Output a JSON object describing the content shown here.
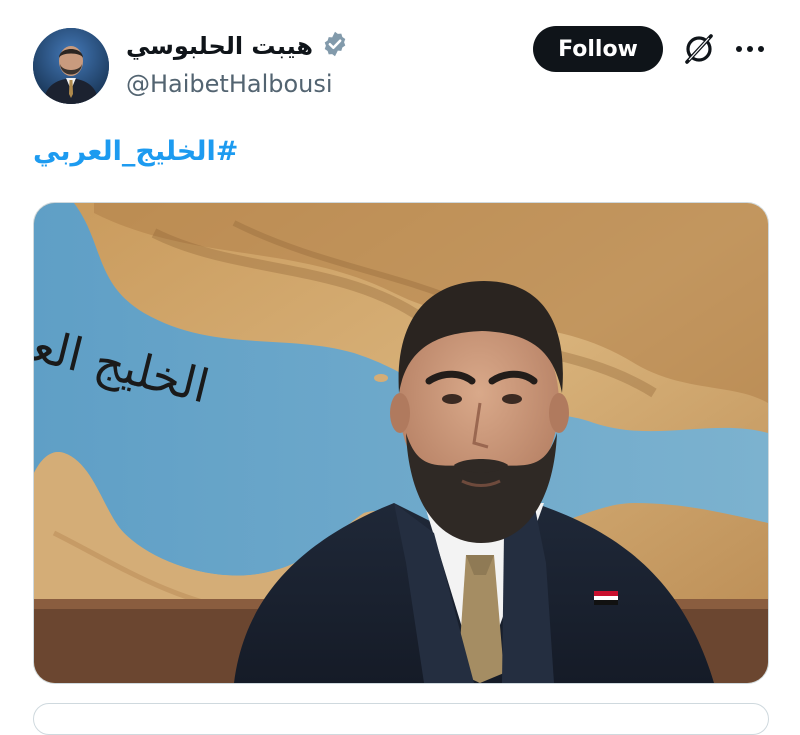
{
  "tweet": {
    "author": {
      "display_name": "هيبت الحلبوسي",
      "handle": "@HaibetHalbousi",
      "verified": true,
      "avatar_icon": "profile-photo"
    },
    "actions": {
      "follow_label": "Follow",
      "grok_icon": "grok-icon",
      "more_icon": "more-options-icon"
    },
    "text": {
      "hashtag": "#الخليج_العربي"
    },
    "media": {
      "handwritten_caption": "الخليج العربي",
      "description_icon": "portrait-over-gulf-map"
    }
  },
  "colors": {
    "accent": "#1d9bf0",
    "button_bg": "#0f1419",
    "secondary_text": "#536471",
    "verified_badge": "#829aab"
  }
}
